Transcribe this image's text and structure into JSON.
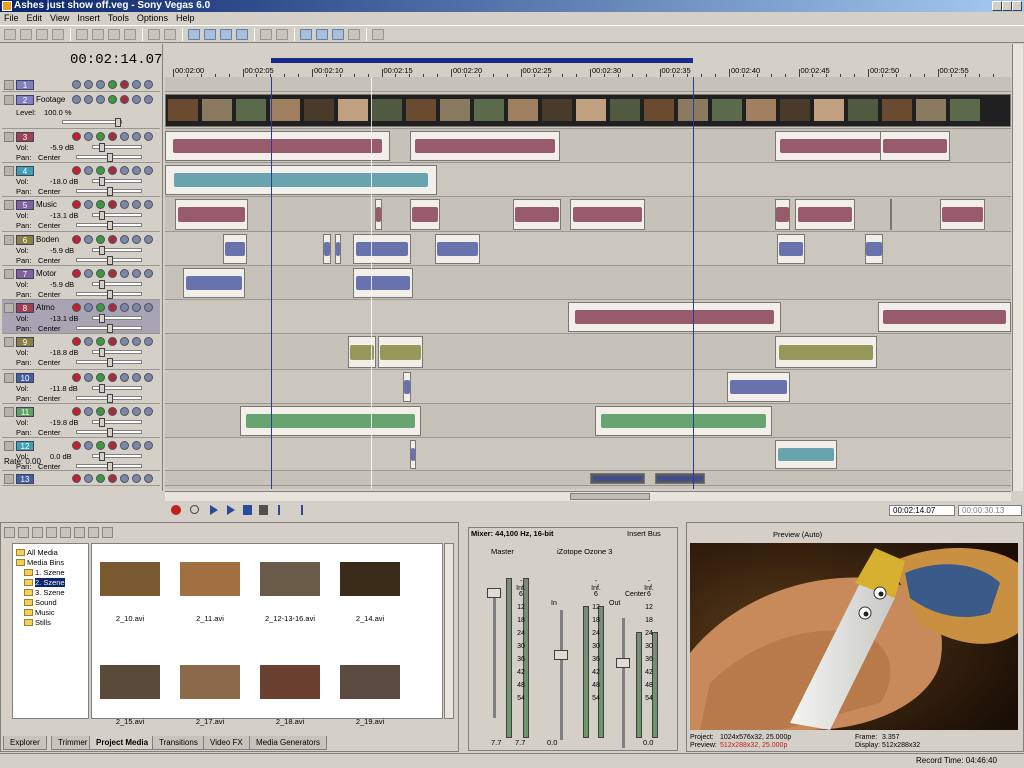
{
  "window": {
    "title": "Ashes just show off.veg - Sony Vegas 6.0"
  },
  "menu": [
    "File",
    "Edit",
    "View",
    "Insert",
    "Tools",
    "Options",
    "Help"
  ],
  "timeline": {
    "cursor_time": "00:02:14.07",
    "ruler_labels": [
      "00:02:00",
      "00:02:05",
      "00:02:10",
      "00:02:15",
      "00:02:20",
      "00:02:25",
      "00:02:30",
      "00:02:35",
      "00:02:40",
      "00:02:45",
      "00:02:50",
      "00:02:55"
    ],
    "rate": "Rate: 0.00",
    "transport_time": "00:02:14.07",
    "transport_time2": "00:00:30.13"
  },
  "tracks": [
    {
      "num": "1",
      "name": "",
      "type": "video",
      "color": "#8080c0"
    },
    {
      "num": "2",
      "name": "Footage",
      "type": "video",
      "color": "#8080c0",
      "level_label": "Level:",
      "level": "100.0 %"
    },
    {
      "num": "3",
      "name": "",
      "type": "audio",
      "color": "#a04050",
      "vol": "-5.9 dB",
      "pan": "Center"
    },
    {
      "num": "4",
      "name": "",
      "type": "audio",
      "color": "#40a0b0",
      "vol": "-18.0 dB",
      "pan": "Center"
    },
    {
      "num": "5",
      "name": "Music",
      "type": "audio",
      "color": "#8060a0",
      "vol": "-13.1 dB",
      "pan": "Center"
    },
    {
      "num": "6",
      "name": "Boden",
      "type": "audio",
      "color": "#8a8040",
      "vol": "-5.9 dB",
      "pan": "Center"
    },
    {
      "num": "7",
      "name": "Motor",
      "type": "audio",
      "color": "#8060a0",
      "vol": "-5.9 dB",
      "pan": "Center"
    },
    {
      "num": "8",
      "name": "Atmo",
      "type": "audio",
      "color": "#a04050",
      "vol": "-13.1 dB",
      "pan": "Center"
    },
    {
      "num": "9",
      "name": "",
      "type": "audio",
      "color": "#8a8040",
      "vol": "-18.8 dB",
      "pan": "Center"
    },
    {
      "num": "10",
      "name": "",
      "type": "audio",
      "color": "#4060a0",
      "vol": "-11.8 dB",
      "pan": "Center"
    },
    {
      "num": "11",
      "name": "",
      "type": "audio",
      "color": "#60a060",
      "vol": "-19.8 dB",
      "pan": "Center"
    },
    {
      "num": "12",
      "name": "",
      "type": "audio",
      "color": "#40a0b0",
      "vol": "0.0 dB",
      "pan": "Center"
    },
    {
      "num": "13",
      "name": "",
      "type": "audio",
      "color": "#4060a0"
    }
  ],
  "labels": {
    "vol": "Vol:",
    "pan": "Pan:"
  },
  "explorer": {
    "tree": [
      "All Media",
      "Media Bins",
      "1. Szene",
      "2. Szene",
      "3. Szene",
      "Sound",
      "Music",
      "Stills"
    ],
    "files": [
      "2_10.avi",
      "2_11.avi",
      "2_12-13-16.avi",
      "2_14.avi",
      "2_15.avi",
      "2_17.avi",
      "2_18.avi",
      "2_19.avi"
    ],
    "tabs": [
      "Explorer",
      "Trimmer",
      "Project Media",
      "Transitions",
      "Video FX",
      "Media Generators"
    ]
  },
  "mixer": {
    "title": "Mixer: 44,100 Hz, 16-bit",
    "insert_bus": "Insert Bus",
    "master": "Master",
    "plugin": "iZotope Ozone 3",
    "center": "Center",
    "scale": [
      "-Inf.",
      "6",
      "12",
      "18",
      "24",
      "30",
      "36",
      "42",
      "48",
      "54"
    ],
    "labels": [
      "In",
      "Out"
    ],
    "values": [
      "7.7",
      "7.7",
      "0.0",
      "0.0"
    ]
  },
  "preview": {
    "title": "Preview (Auto)",
    "project_label": "Project:",
    "project": "1024x576x32, 25.000p",
    "preview_label": "Preview:",
    "preview_val": "512x288x32, 25.000p",
    "frame_label": "Frame:",
    "frame": "3.357",
    "display_label": "Display:",
    "display": "512x288x32"
  },
  "status": {
    "record_time": "Record Time: 04:46:40"
  },
  "colors": {
    "accent": "#0a246a",
    "cursor": "#1a2a8a",
    "wave_red": "#7a2a40",
    "wave_green": "#3a8a4a",
    "wave_teal": "#3a8a9a",
    "wave_blue": "#3a4a9a"
  }
}
